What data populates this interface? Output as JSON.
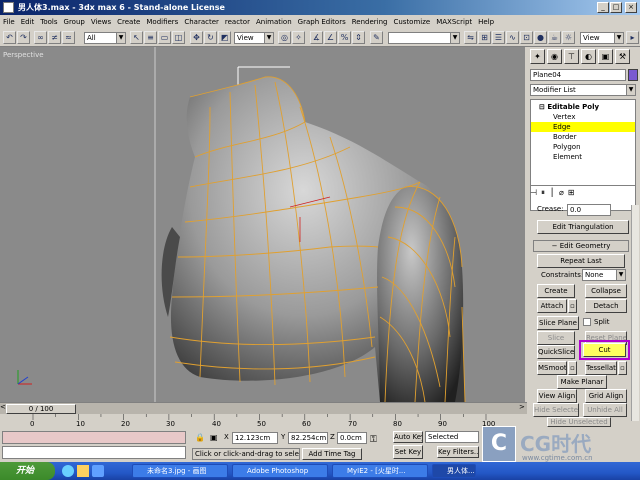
{
  "window": {
    "title": "男人体3.max - 3dx max 6 - Stand-alone License"
  },
  "menu": [
    "File",
    "Edit",
    "Tools",
    "Group",
    "Views",
    "Create",
    "Modifiers",
    "Character",
    "reactor",
    "Animation",
    "Graph Editors",
    "Rendering",
    "Customize",
    "MAXScript",
    "Help"
  ],
  "toolbar": {
    "selection_filter": "All",
    "ref_coord_1": "View",
    "ref_coord_2": "View"
  },
  "viewport": {
    "label": "Perspective"
  },
  "command_panel": {
    "object_name": "Plane04",
    "modifier_list": "Modifier List",
    "stack": {
      "root": "Editable Poly",
      "items": [
        "Vertex",
        "Edge",
        "Border",
        "Polygon",
        "Element"
      ],
      "selected": "Edge"
    },
    "crease_label": "Crease:",
    "crease_value": "0.0",
    "edit_triangulation": "Edit Triangulation",
    "rollout_title": "Edit Geometry",
    "repeat_last": "Repeat Last",
    "constraints_label": "Constraints:",
    "constraints_value": "None",
    "buttons": {
      "create": "Create",
      "collapse": "Collapse",
      "attach": "Attach",
      "detach": "Detach",
      "slice_plane": "Slice Plane",
      "split": "Split",
      "slice": "Slice",
      "reset_plane": "Reset Plane",
      "quickslice": "QuickSlice",
      "cut": "Cut",
      "msmooth": "MSmooth",
      "tessellate": "Tessellate",
      "make_planar": "Make Planar",
      "view_align": "View Align",
      "grid_align": "Grid Align",
      "hide_selected": "Hide Selected",
      "unhide_all": "Unhide All",
      "hide_unselected": "Hide Unselected"
    }
  },
  "timeline": {
    "frame": "0 / 100",
    "ticks": [
      "0",
      "10",
      "20",
      "30",
      "40",
      "50",
      "60",
      "70",
      "80",
      "90",
      "100"
    ]
  },
  "status": {
    "prompt": "Click or click-and-drag to select obj",
    "add_time_tag": "Add Time Tag",
    "x_label": "X",
    "x_value": "12.123cm",
    "y_label": "Y",
    "y_value": "82.254cm",
    "z_label": "Z",
    "z_value": "0.0cm",
    "auto_key": "Auto Key",
    "selected": "Selected",
    "set_key": "Set Key",
    "key_filters": "Key Filters..."
  },
  "taskbar": {
    "start": "开始",
    "tasks": [
      "未命名3.jpg - 画图",
      "Adobe Photoshop",
      "MyIE2 - [火星时...",
      "男人体..."
    ]
  },
  "watermark": {
    "brand": "CG时代",
    "url": "www.cgtime.com.cn"
  },
  "colors": {
    "highlight_cut": "#b000d0",
    "stack_selected": "#ffff00",
    "wireframe": "#e0a030"
  }
}
